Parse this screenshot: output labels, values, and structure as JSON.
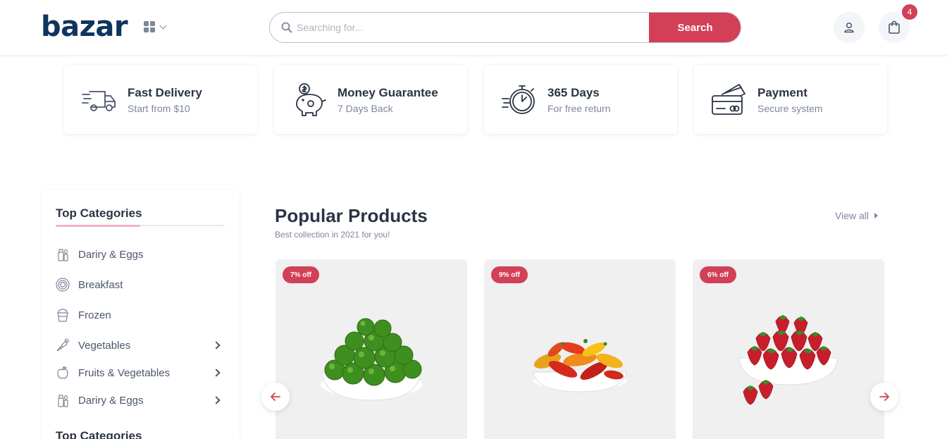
{
  "header": {
    "logo": "bazar",
    "search_placeholder": "Searching for...",
    "search_button": "Search",
    "cart_count": "4"
  },
  "services": [
    {
      "title": "Fast Delivery",
      "subtitle": "Start from $10",
      "icon": "truck-icon"
    },
    {
      "title": "Money Guarantee",
      "subtitle": "7 Days Back",
      "icon": "piggy-bank-icon"
    },
    {
      "title": "365 Days",
      "subtitle": "For free return",
      "icon": "stopwatch-icon"
    },
    {
      "title": "Payment",
      "subtitle": "Secure system",
      "icon": "credit-card-icon"
    }
  ],
  "sidebar": {
    "title": "Top Categories",
    "items": [
      {
        "label": "Dariry & Eggs",
        "icon": "milk-bottle-icon",
        "has_arrow": false
      },
      {
        "label": "Breakfast",
        "icon": "plate-icon",
        "has_arrow": false
      },
      {
        "label": "Frozen",
        "icon": "frozen-cup-icon",
        "has_arrow": false
      },
      {
        "label": "Vegetables",
        "icon": "carrot-icon",
        "has_arrow": true
      },
      {
        "label": "Fruits & Vegetables",
        "icon": "apple-icon",
        "has_arrow": true
      },
      {
        "label": "Dariry & Eggs",
        "icon": "milk-bottle-icon",
        "has_arrow": true
      }
    ],
    "title2": "Top Categories"
  },
  "products_section": {
    "title": "Popular Products",
    "subtitle": "Best collection in 2021 for you!",
    "view_all": "View all"
  },
  "products": [
    {
      "discount": "7% off",
      "image": "limes-bowl"
    },
    {
      "discount": "9% off",
      "image": "peppers-bowl"
    },
    {
      "discount": "6% off",
      "image": "strawberries-bowl"
    }
  ],
  "colors": {
    "primary": "#d23f57",
    "brand": "#0f3460",
    "text": "#2b3445",
    "muted": "#7d879c"
  }
}
